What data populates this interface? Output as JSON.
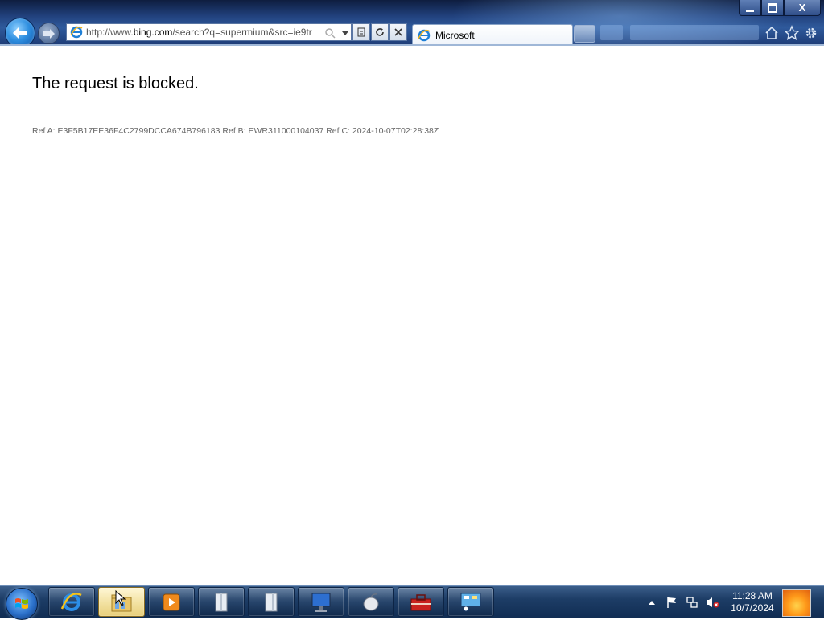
{
  "browser": {
    "url_prefix": "http://www.",
    "url_domain": "bing.com",
    "url_rest": "/search?q=supermium&src=ie9tr",
    "tab_title": "Microsoft"
  },
  "page": {
    "headline": "The request is blocked.",
    "ref_text": "Ref A: E3F5B17EE36F4C2799DCCA674B796183 Ref B: EWR311000104037 Ref C: 2024-10-07T02:28:38Z"
  },
  "taskbar": {
    "time": "11:28 AM",
    "date": "10/7/2024",
    "pinned": [
      "internet-explorer",
      "windows-explorer",
      "media-player",
      "app-4",
      "app-5",
      "computer",
      "mouse-app",
      "toolbox-app",
      "control-panel"
    ]
  },
  "colors": {
    "chrome_dark": "#0e1d3f",
    "taskbar": "#1d3d66",
    "active_taskbar_button": "#f3e3a5"
  }
}
